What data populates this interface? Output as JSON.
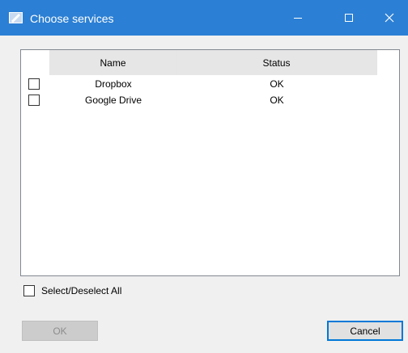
{
  "window": {
    "title": "Choose services",
    "accent_color": "#2b7fd4",
    "controls": {
      "minimize_icon": "minimize-icon",
      "maximize_icon": "maximize-icon",
      "close_icon": "close-icon"
    }
  },
  "list": {
    "columns": [
      "Name",
      "Status"
    ],
    "rows": [
      {
        "name": "Dropbox",
        "status": "OK",
        "checked": false
      },
      {
        "name": "Google Drive",
        "status": "OK",
        "checked": false
      }
    ]
  },
  "select_all": {
    "label": "Select/Deselect All",
    "checked": false
  },
  "buttons": {
    "ok": "OK",
    "ok_enabled": false,
    "cancel": "Cancel"
  }
}
